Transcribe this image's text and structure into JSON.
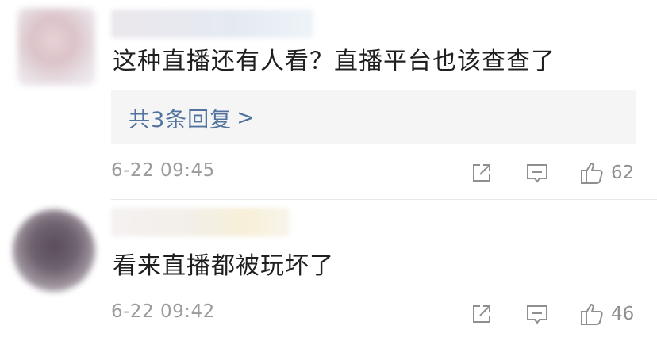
{
  "comments": [
    {
      "text": "这种直播还有人看？直播平台也该查查了",
      "replies_label": "共3条回复",
      "replies_arrow": ">",
      "timestamp": "6-22 09:45",
      "likes": "62"
    },
    {
      "text": "看来直播都被玩坏了",
      "timestamp": "6-22 09:42",
      "likes": "46"
    }
  ],
  "icons": {
    "share": "share-icon",
    "comment": "comment-icon",
    "like": "thumbs-up-icon"
  },
  "colors": {
    "text": "#1f1f1f",
    "link": "#52739e",
    "meta": "#9b9b9b",
    "icon": "#8f8f8f"
  }
}
